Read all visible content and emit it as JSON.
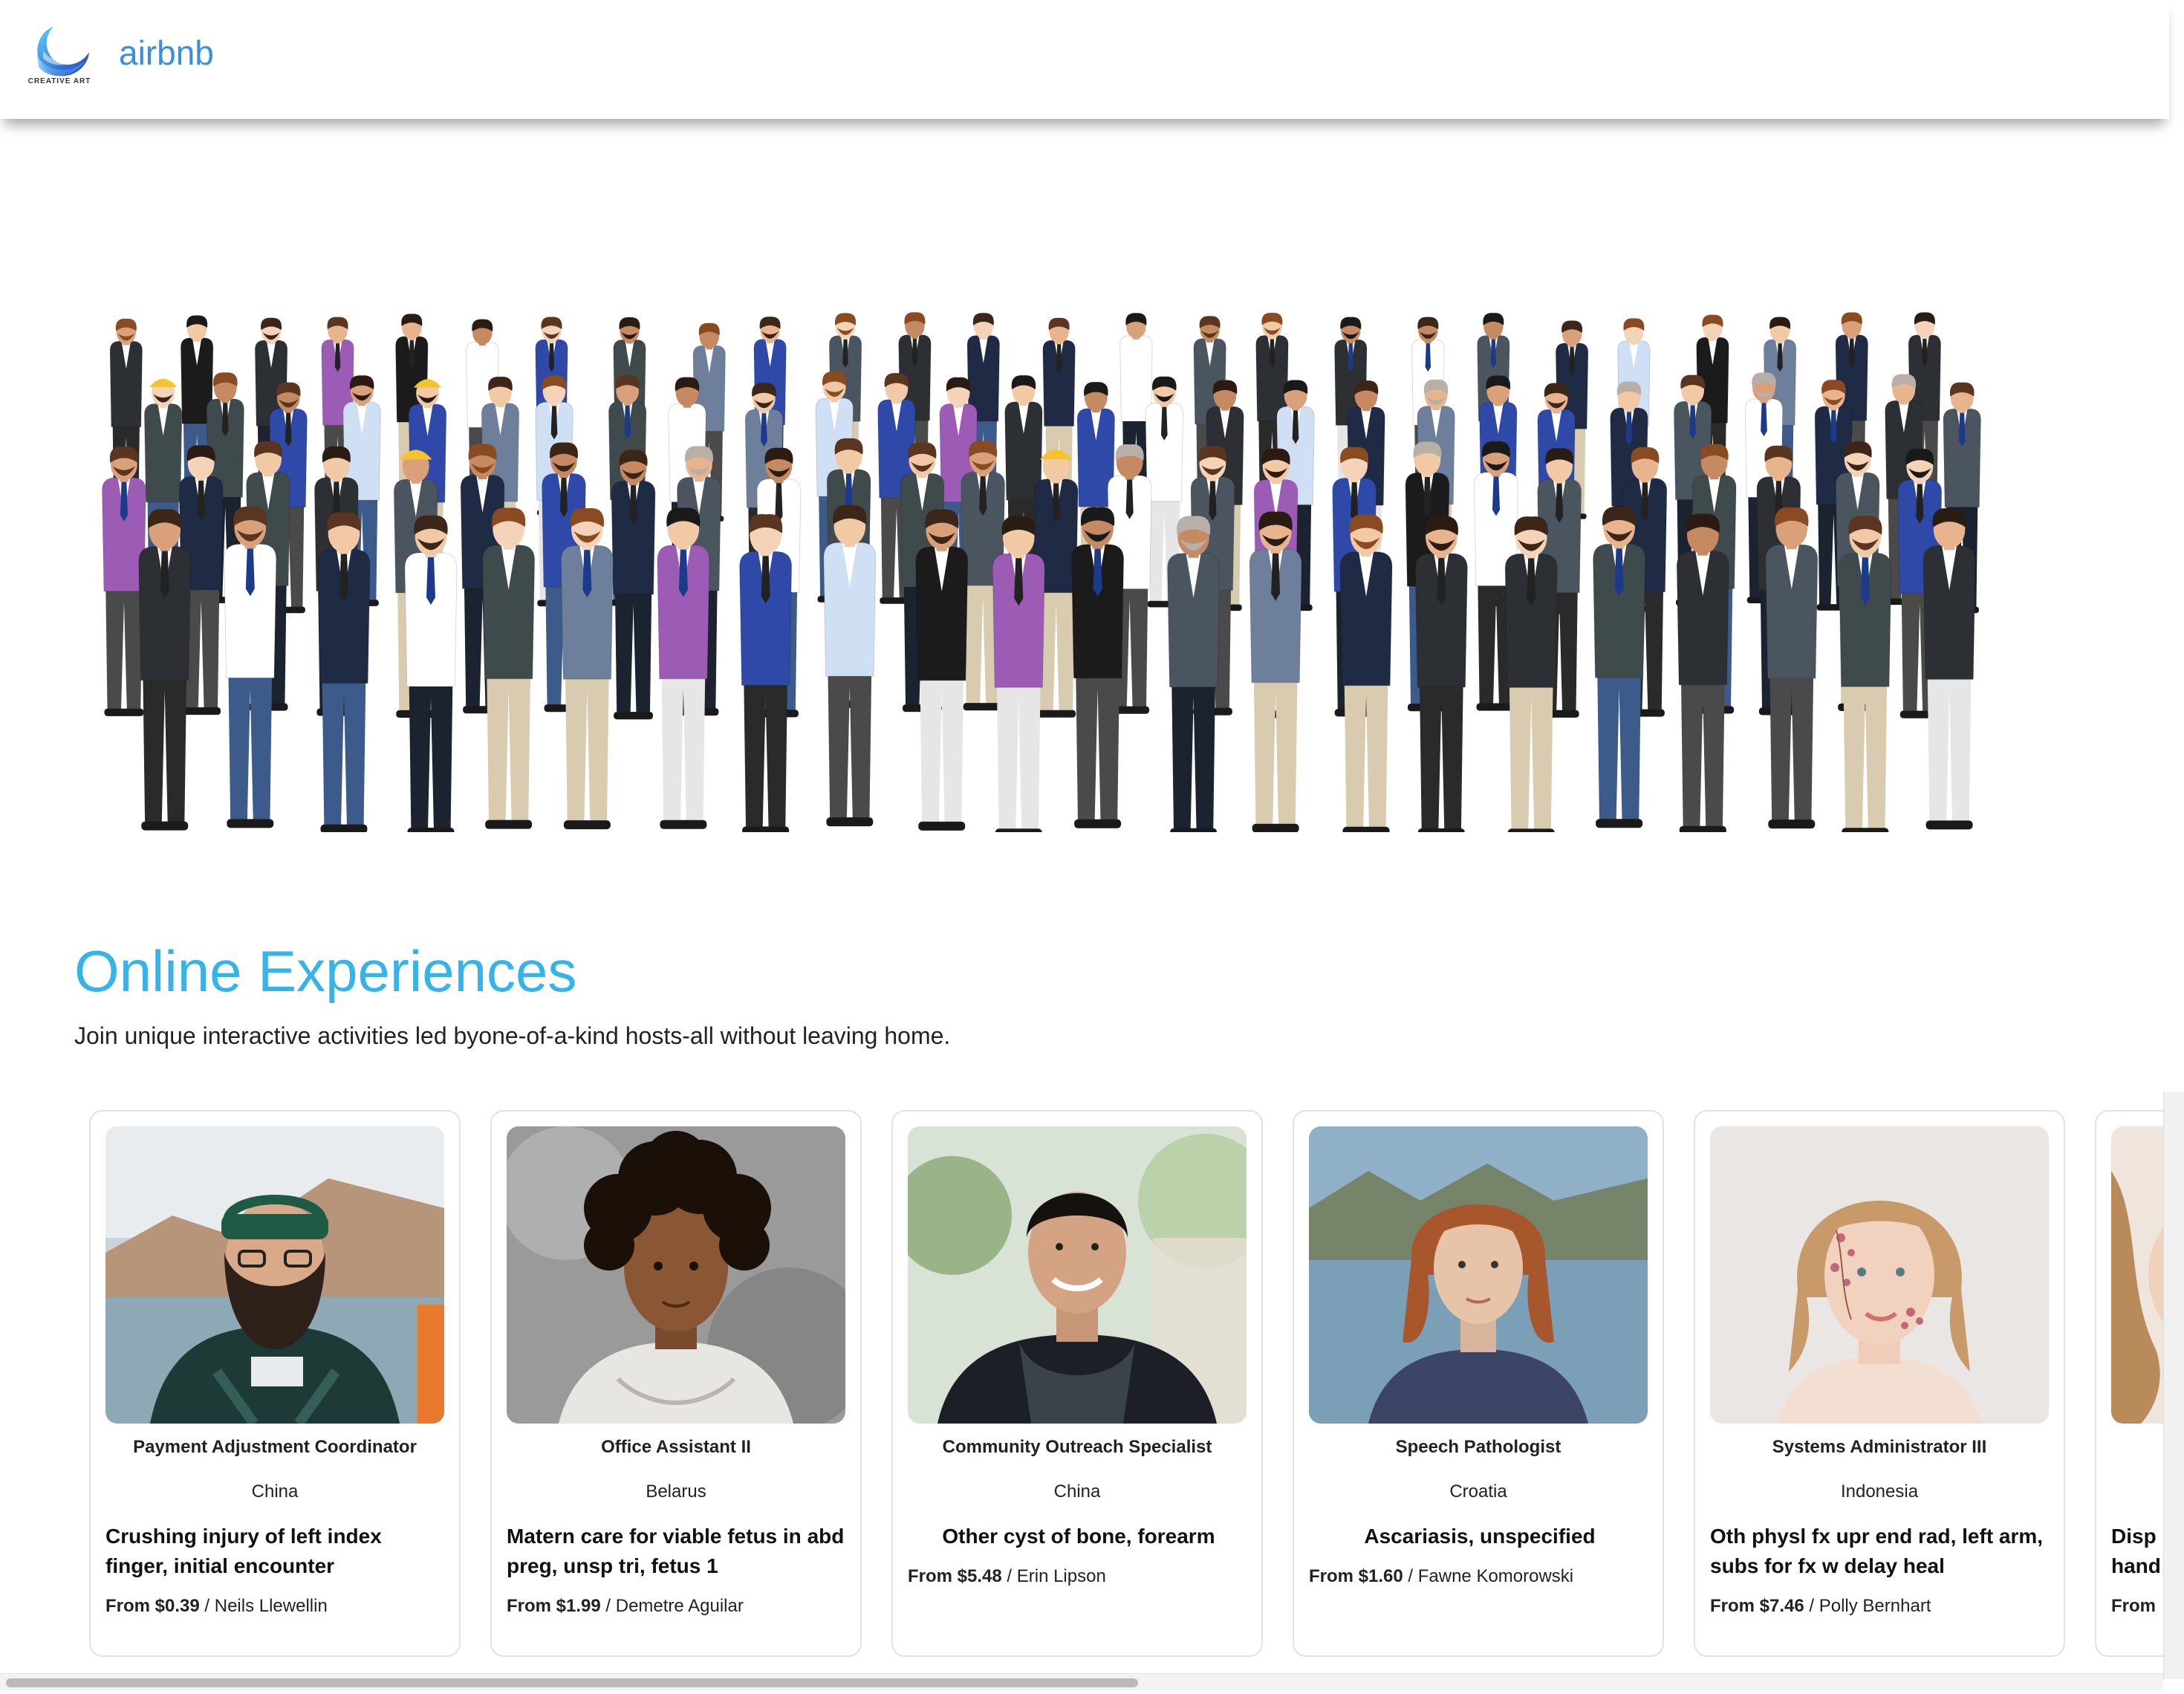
{
  "header": {
    "logo_caption": "CREATIVE ART",
    "brand": "airbnb"
  },
  "hero": {
    "image": "crowd-of-professionals-illustration"
  },
  "section": {
    "title": "Online Experiences",
    "subtitle": "Join unique interactive activities led byone-of-a-kind hosts-all without leaving home."
  },
  "cards": [
    {
      "role": "Payment Adjustment Coordinator",
      "country": "China",
      "title": "Crushing injury of left index finger, initial encounter",
      "price": "From $0.39",
      "host": " / Neils Llewellin",
      "photo": "bearded-man-beanie"
    },
    {
      "role": "Office Assistant II",
      "country": "Belarus",
      "title": "Matern care for viable fetus in abd preg, unsp tri, fetus 1",
      "price": "From $1.99",
      "host": " / Demetre Aguilar",
      "photo": "curly-haired-child"
    },
    {
      "role": "Community Outreach Specialist",
      "country": "China",
      "title": "Other cyst of bone, forearm",
      "price": "From $5.48",
      "host": " / Erin Lipson",
      "photo": "smiling-man-scarf"
    },
    {
      "role": "Speech Pathologist",
      "country": "Croatia",
      "title": "Ascariasis, unspecified",
      "price": "From $1.60",
      "host": " / Fawne Komorowski",
      "photo": "red-haired-woman"
    },
    {
      "role": "Systems Administrator III",
      "country": "Indonesia",
      "title": "Oth physl fx upr end rad, left arm, subs for fx w delay heal",
      "price": "From $7.46",
      "host": " / Polly Bernhart",
      "photo": "woman-floral-makeup"
    },
    {
      "role": "",
      "country": "",
      "title": "Disp hand",
      "price": "From",
      "host": "",
      "photo": "woman-wavy-hair"
    }
  ],
  "colors": {
    "brand": "#3a8fd8",
    "section_title": "#36b3e8",
    "card_border": "#e2e2e2"
  }
}
